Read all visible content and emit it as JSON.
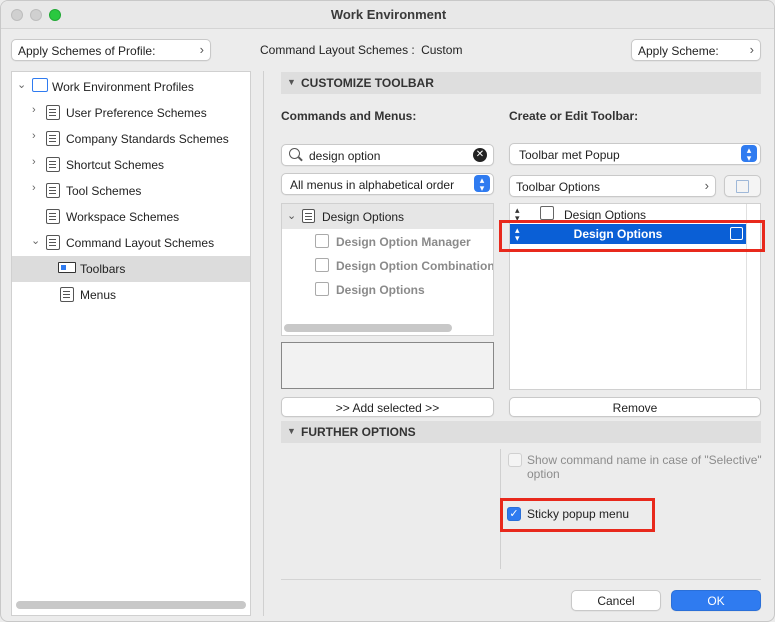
{
  "window": {
    "title": "Work Environment"
  },
  "top": {
    "apply_profile_label": "Apply Schemes of Profile:",
    "scheme_caption": "Command Layout Schemes :",
    "scheme_value": "Custom",
    "apply_scheme_label": "Apply Scheme:"
  },
  "tree": {
    "root": "Work Environment Profiles",
    "items": [
      {
        "label": "User Preference Schemes"
      },
      {
        "label": "Company Standards Schemes"
      },
      {
        "label": "Shortcut Schemes"
      },
      {
        "label": "Tool Schemes"
      },
      {
        "label": "Workspace Schemes"
      },
      {
        "label": "Command Layout Schemes"
      },
      {
        "label": "Toolbars"
      },
      {
        "label": "Menus"
      }
    ]
  },
  "customize": {
    "header": "CUSTOMIZE TOOLBAR",
    "commands_heading": "Commands and Menus:",
    "search_value": "design option",
    "menus_filter": "All menus in alphabetical order",
    "command_group": "Design Options",
    "commands": [
      {
        "label": "Design Option Manager"
      },
      {
        "label": "Design Option Combination I"
      },
      {
        "label": "Design Options"
      }
    ],
    "add_selected": ">> Add selected >>",
    "toolbar_heading": "Create or Edit Toolbar:",
    "toolbar_select": "Toolbar met Popup",
    "toolbar_options": "Toolbar Options",
    "toolbar_items": [
      {
        "label": "Design Options"
      },
      {
        "label": "Design Options"
      }
    ],
    "remove": "Remove"
  },
  "further": {
    "header": "FURTHER OPTIONS",
    "show_name_label_1": "Show command name in case of \"Selective\"",
    "show_name_label_2": "option",
    "show_name_checked": false,
    "sticky_label": "Sticky popup menu",
    "sticky_checked": true
  },
  "footer": {
    "cancel": "Cancel",
    "ok": "OK"
  },
  "colors": {
    "accent": "#2f7bf0",
    "highlight_box": "#e8291c",
    "selection": "#0a5fd6"
  }
}
